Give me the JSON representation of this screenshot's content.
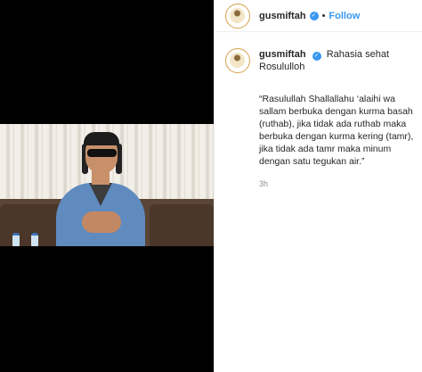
{
  "header": {
    "username": "gusmiftah",
    "separator": "•",
    "follow_label": "Follow"
  },
  "caption": {
    "username": "gusmiftah",
    "title": "Rahasia sehat Rosululloh",
    "quote": "“Rasulullah Shallallahu ‘alaihi wa\nsallam berbuka dengan kurma basah\n(ruthab), jika tidak ada ruthab maka\nberbuka dengan kurma kering (tamr),\njika tidak ada tamr maka minum\ndengan satu tegukan air.”",
    "time": "3h"
  },
  "icons": {
    "verified": "verified-badge-icon",
    "avatar": "profile-avatar"
  },
  "colors": {
    "link_blue": "#3897f0",
    "text": "#262626",
    "muted": "#8e8e8e",
    "media_bg": "#000000"
  }
}
